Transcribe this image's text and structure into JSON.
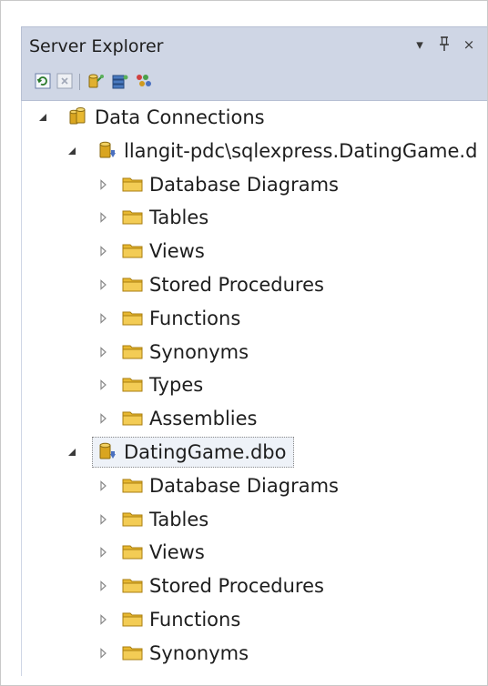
{
  "window": {
    "title": "Server Explorer",
    "dropdown_glyph": "▾",
    "pin_glyph": "ꝑ",
    "close_glyph": "×"
  },
  "toolbar": {
    "buttons": [
      {
        "name": "refresh-icon"
      },
      {
        "name": "stop-icon"
      },
      {
        "name": "connect-to-database-icon"
      },
      {
        "name": "connect-to-server-icon"
      },
      {
        "name": "connect-to-sharepoint-icon"
      }
    ]
  },
  "tree": {
    "root": {
      "label": "Data Connections",
      "expanded": true
    },
    "connections": [
      {
        "label": "llangit-pdc\\sqlexpress.DatingGame.d",
        "expanded": true,
        "selected": false,
        "folders": [
          "Database Diagrams",
          "Tables",
          "Views",
          "Stored Procedures",
          "Functions",
          "Synonyms",
          "Types",
          "Assemblies"
        ]
      },
      {
        "label": "DatingGame.dbo",
        "expanded": true,
        "selected": true,
        "folders": [
          "Database Diagrams",
          "Tables",
          "Views",
          "Stored Procedures",
          "Functions",
          "Synonyms"
        ]
      }
    ]
  },
  "colors": {
    "chrome": "#cfd6e5",
    "folder": "#e8b830",
    "database": "#d9a520",
    "text": "#1e1e1e"
  }
}
